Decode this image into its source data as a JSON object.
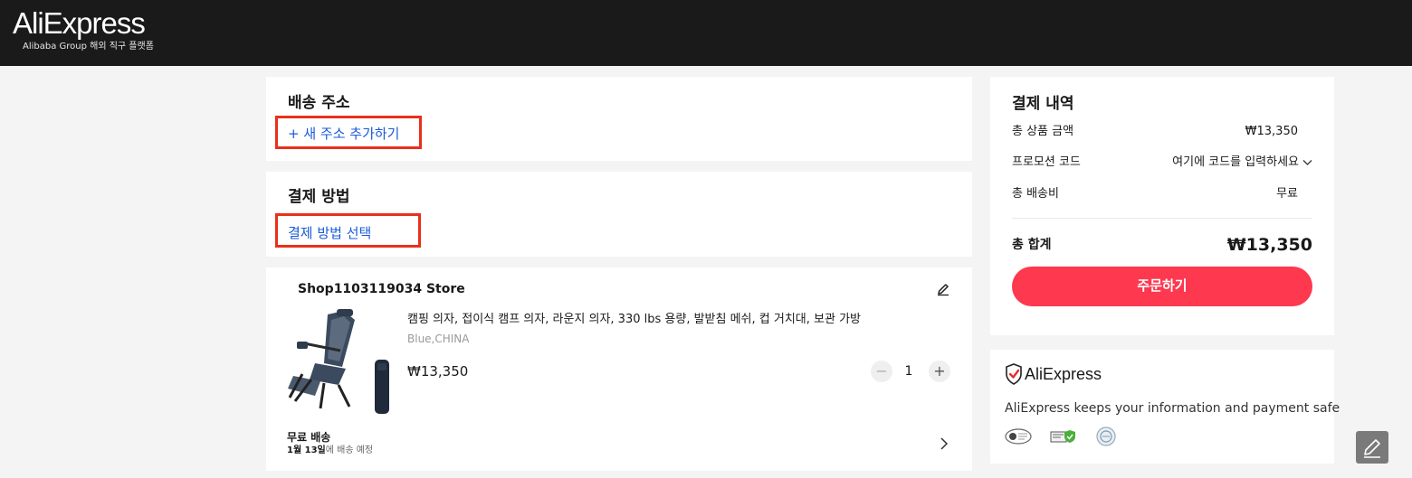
{
  "header": {
    "logo_text": "AliExpress",
    "logo_subtitle": "Alibaba Group 해외 직구 플랫폼"
  },
  "shipping": {
    "title": "배송 주소",
    "add_address_link": "+ 새 주소 추가하기"
  },
  "payment": {
    "title": "결제 방법",
    "select_link": "결제 방법 선택"
  },
  "order_item": {
    "store_name": "Shop1103119034 Store",
    "product_title": "캠핑 의자, 접이식 캠프 의자, 라운지 의자, 330 lbs 용량, 발받침 메쉬, 컵 거치대, 보관 가방",
    "variant": "Blue,CHINA",
    "price": "₩13,350",
    "quantity": "1",
    "qty_minus": "−",
    "qty_plus": "+",
    "shipping_label": "무료 배송",
    "delivery_date": "1월 13일",
    "delivery_suffix": "에 배송 예정"
  },
  "summary": {
    "title": "결제 내역",
    "rows": [
      {
        "label": "총 상품 금액",
        "value": "₩13,350"
      },
      {
        "label": "프로모션 코드",
        "value": "여기에 코드를 입력하세요"
      },
      {
        "label": "총 배송비",
        "value": "무료"
      }
    ],
    "total_label": "총 합계",
    "total_value": "₩13,350",
    "order_button": "주문하기"
  },
  "security": {
    "brand": "AliExpress",
    "message": "AliExpress keeps your information and payment safe"
  },
  "colors": {
    "header_bg": "#1a1a1a",
    "accent_red": "#fd384f",
    "link_blue": "#1a5bd8",
    "highlight_box": "#e8301c"
  }
}
